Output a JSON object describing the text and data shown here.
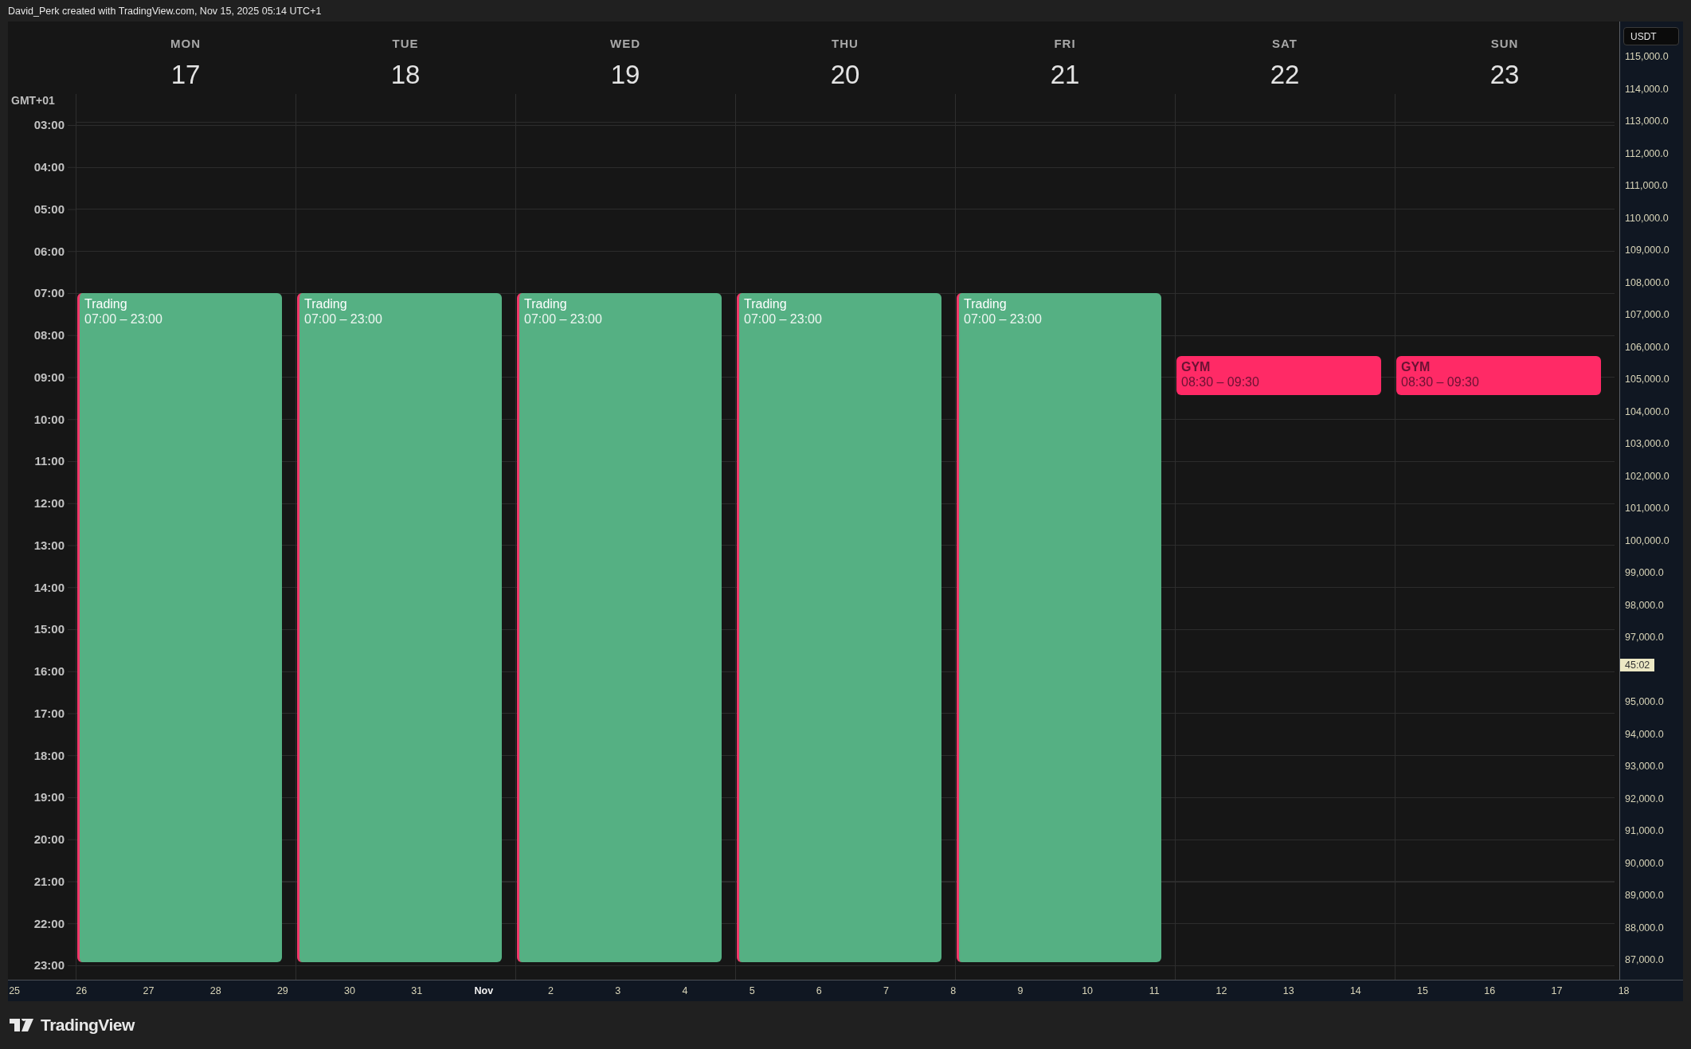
{
  "header": {
    "caption": "David_Perk created with TradingView.com, Nov 15, 2025 05:14 UTC+1"
  },
  "calendar": {
    "timezone": "GMT+01",
    "hours": [
      "03:00",
      "04:00",
      "05:00",
      "06:00",
      "07:00",
      "08:00",
      "09:00",
      "10:00",
      "11:00",
      "12:00",
      "13:00",
      "14:00",
      "15:00",
      "16:00",
      "17:00",
      "18:00",
      "19:00",
      "20:00",
      "21:00",
      "22:00",
      "23:00"
    ],
    "days": [
      {
        "name": "MON",
        "date": "17",
        "events": [
          {
            "kind": "trading",
            "title": "Trading",
            "time": "07:00 – 23:00",
            "color": "#55b083"
          }
        ]
      },
      {
        "name": "TUE",
        "date": "18",
        "events": [
          {
            "kind": "trading",
            "title": "Trading",
            "time": "07:00 – 23:00",
            "color": "#55b083"
          }
        ]
      },
      {
        "name": "WED",
        "date": "19",
        "events": [
          {
            "kind": "trading",
            "title": "Trading",
            "time": "07:00 – 23:00",
            "color": "#55b083"
          }
        ]
      },
      {
        "name": "THU",
        "date": "20",
        "events": [
          {
            "kind": "trading",
            "title": "Trading",
            "time": "07:00 – 23:00",
            "color": "#55b083"
          }
        ]
      },
      {
        "name": "FRI",
        "date": "21",
        "events": [
          {
            "kind": "trading",
            "title": "Trading",
            "time": "07:00 – 23:00",
            "color": "#55b083"
          }
        ]
      },
      {
        "name": "SAT",
        "date": "22",
        "events": [
          {
            "kind": "gym",
            "title": "GYM",
            "time": "08:30 – 09:30",
            "color": "#ff2a66"
          }
        ]
      },
      {
        "name": "SUN",
        "date": "23",
        "events": [
          {
            "kind": "gym",
            "title": "GYM",
            "time": "08:30 – 09:30",
            "color": "#ff2a66"
          }
        ]
      }
    ]
  },
  "price_axis": {
    "currency": "USDT",
    "labels": [
      {
        "kind": "price",
        "text": "115,000.0"
      },
      {
        "kind": "price",
        "text": "114,000.0"
      },
      {
        "kind": "price",
        "text": "113,000.0"
      },
      {
        "kind": "price",
        "text": "112,000.0"
      },
      {
        "kind": "price",
        "text": "111,000.0"
      },
      {
        "kind": "price",
        "text": "110,000.0"
      },
      {
        "kind": "price",
        "text": "109,000.0"
      },
      {
        "kind": "price",
        "text": "108,000.0"
      },
      {
        "kind": "price",
        "text": "107,000.0"
      },
      {
        "kind": "price",
        "text": "106,000.0"
      },
      {
        "kind": "price",
        "text": "105,000.0"
      },
      {
        "kind": "price",
        "text": "104,000.0"
      },
      {
        "kind": "price",
        "text": "103,000.0"
      },
      {
        "kind": "price",
        "text": "102,000.0"
      },
      {
        "kind": "price",
        "text": "101,000.0"
      },
      {
        "kind": "price",
        "text": "100,000.0"
      },
      {
        "kind": "price",
        "text": "99,000.0"
      },
      {
        "kind": "price",
        "text": "98,000.0"
      },
      {
        "kind": "price",
        "text": "97,000.0"
      },
      {
        "kind": "countdown",
        "text": "45:02"
      },
      {
        "kind": "price",
        "text": "95,000.0"
      },
      {
        "kind": "price",
        "text": "94,000.0"
      },
      {
        "kind": "price",
        "text": "93,000.0"
      },
      {
        "kind": "price",
        "text": "92,000.0"
      },
      {
        "kind": "price",
        "text": "91,000.0"
      },
      {
        "kind": "price",
        "text": "90,000.0"
      },
      {
        "kind": "price",
        "text": "89,000.0"
      },
      {
        "kind": "price",
        "text": "88,000.0"
      },
      {
        "kind": "price",
        "text": "87,000.0"
      }
    ]
  },
  "time_axis": {
    "labels": [
      {
        "kind": "day",
        "text": "25"
      },
      {
        "kind": "day",
        "text": "26"
      },
      {
        "kind": "day",
        "text": "27"
      },
      {
        "kind": "day",
        "text": "28"
      },
      {
        "kind": "day",
        "text": "29"
      },
      {
        "kind": "day",
        "text": "30"
      },
      {
        "kind": "day",
        "text": "31"
      },
      {
        "kind": "month",
        "text": "Nov"
      },
      {
        "kind": "day",
        "text": "2"
      },
      {
        "kind": "day",
        "text": "3"
      },
      {
        "kind": "day",
        "text": "4"
      },
      {
        "kind": "day",
        "text": "5"
      },
      {
        "kind": "day",
        "text": "6"
      },
      {
        "kind": "day",
        "text": "7"
      },
      {
        "kind": "day",
        "text": "8"
      },
      {
        "kind": "day",
        "text": "9"
      },
      {
        "kind": "day",
        "text": "10"
      },
      {
        "kind": "day",
        "text": "11"
      },
      {
        "kind": "day",
        "text": "12"
      },
      {
        "kind": "day",
        "text": "13"
      },
      {
        "kind": "day",
        "text": "14"
      },
      {
        "kind": "day",
        "text": "15"
      },
      {
        "kind": "day",
        "text": "16"
      },
      {
        "kind": "day",
        "text": "17"
      },
      {
        "kind": "day",
        "text": "18"
      }
    ]
  },
  "footer": {
    "logo": "TradingView"
  }
}
